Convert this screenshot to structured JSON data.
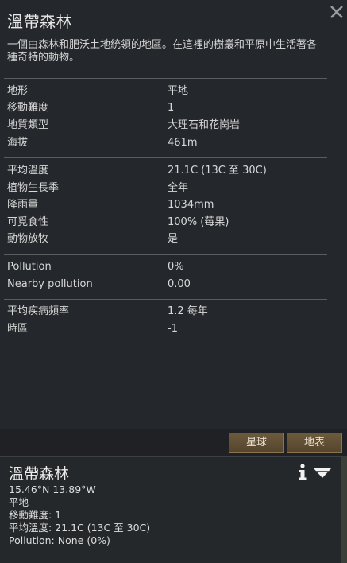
{
  "panel": {
    "title": "溫帶森林",
    "description": "一個由森林和肥沃土地統領的地區。在這裡的樹叢和平原中生活著各種奇特的動物。"
  },
  "stats_group1": [
    {
      "label": "地形",
      "value": "平地"
    },
    {
      "label": "移動難度",
      "value": "1"
    },
    {
      "label": "地質類型",
      "value": "大理石和花崗岩"
    },
    {
      "label": "海拔",
      "value": "461m"
    }
  ],
  "stats_group2": [
    {
      "label": "平均溫度",
      "value": "21.1C (13C 至 30C)"
    },
    {
      "label": "植物生長季",
      "value": "全年"
    },
    {
      "label": "降雨量",
      "value": "1034mm"
    },
    {
      "label": "可覓食性",
      "value": "100% (莓果)"
    },
    {
      "label": "動物放牧",
      "value": "是"
    }
  ],
  "stats_group3": [
    {
      "label": "Pollution",
      "value": "0%"
    },
    {
      "label": "Nearby pollution",
      "value": "0.00"
    }
  ],
  "stats_group4": [
    {
      "label": "平均疾病頻率",
      "value": "1.2 每年"
    },
    {
      "label": "時區",
      "value": "-1"
    }
  ],
  "tabs": {
    "planet": "星球",
    "surface": "地表"
  },
  "inspect": {
    "title": "溫帶森林",
    "coords": "15.46°N 13.89°W",
    "terrain": "平地",
    "movement": "移動難度: 1",
    "temperature": "平均溫度: 21.1C (13C 至 30C)",
    "pollution": "Pollution: None (0%)"
  },
  "icons": {
    "close": "close-icon",
    "info": "info-icon",
    "dropdown": "chevron-down-icon"
  }
}
